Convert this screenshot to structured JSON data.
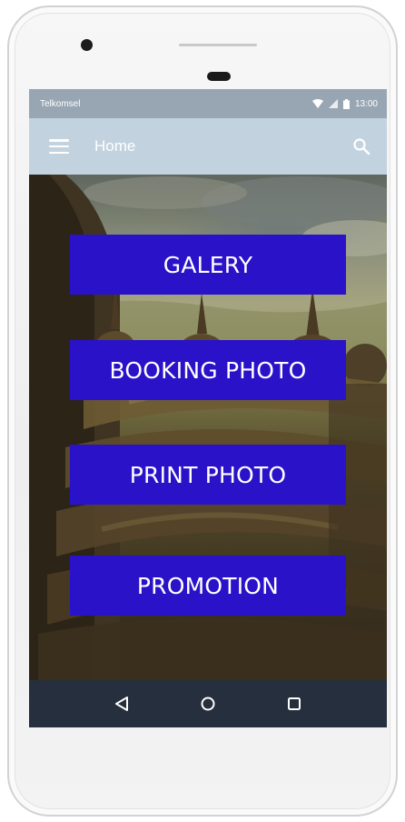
{
  "status_bar": {
    "carrier": "Telkomsel",
    "time": "13:00",
    "icons": [
      "wifi-icon",
      "signal-icon",
      "battery-icon"
    ]
  },
  "app_bar": {
    "title": "Home",
    "menu_icon": "hamburger-menu-icon",
    "search_icon": "search-icon"
  },
  "menu": {
    "items": [
      {
        "label": "GALERY"
      },
      {
        "label": "BOOKING PHOTO"
      },
      {
        "label": "PRINT PHOTO"
      },
      {
        "label": "PROMOTION"
      }
    ]
  },
  "nav_bar": {
    "icons": [
      "back-icon",
      "home-icon",
      "recents-icon"
    ]
  },
  "colors": {
    "button_bg": "#2a12c8",
    "app_bar_bg": "#c3d2df",
    "status_bar_bg": "#98a6b3",
    "nav_bar_bg": "#262f3d"
  }
}
